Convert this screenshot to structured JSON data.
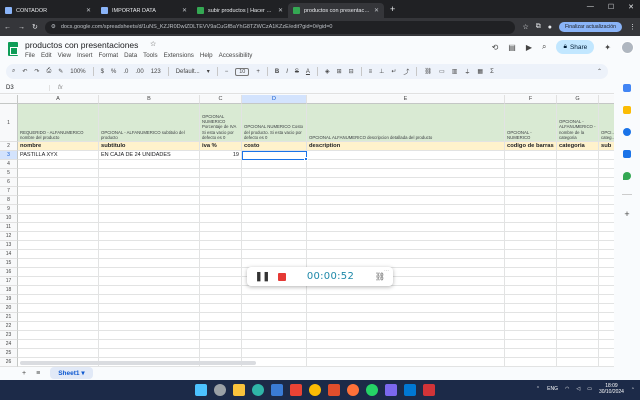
{
  "browser": {
    "tabs": [
      {
        "label": "CONTADOR",
        "color": "#8ab4f8",
        "active": false
      },
      {
        "label": "IMPORTAR DATA",
        "color": "#8ab4f8",
        "active": false
      },
      {
        "label": "subir productos | Hacer copia",
        "color": "#34a853",
        "active": false
      },
      {
        "label": "productos con presentaciones",
        "color": "#34a853",
        "active": true
      }
    ],
    "url": "docs.google.com/spreadsheets/d/1uNS_KZJR0DwlZDLTEVV9aCuGfBaYhG8TZWCzA1KZzE/edit?gid=0#gid=0",
    "update_button": "Finalizar actualización"
  },
  "sheets": {
    "title": "productos con presentaciones",
    "menus": [
      "File",
      "Edit",
      "View",
      "Insert",
      "Format",
      "Data",
      "Tools",
      "Extensions",
      "Help",
      "Accessibility"
    ],
    "share_label": "Share",
    "zoom": "100%",
    "font": "Default...",
    "font_size": "10",
    "name_box": "D3",
    "columns": [
      "A",
      "B",
      "C",
      "D",
      "E",
      "F",
      "G",
      "H"
    ],
    "rows": [
      "1",
      "2",
      "3",
      "4",
      "5",
      "6",
      "7",
      "8",
      "9",
      "10",
      "11",
      "12",
      "13",
      "14",
      "15",
      "16",
      "17",
      "18",
      "19",
      "20",
      "21",
      "22",
      "23",
      "24",
      "25",
      "26",
      "27",
      "28"
    ],
    "row1": [
      "REQUERIDO - ALFANUMERICO nombre del producto",
      "OPCIONAL - ALFANUMERICO subtitulo del producto",
      "OPCIONAL NUMERICO Porcentaje de IVA Si esta vacio por defecto es 0",
      "OPCIONAL NUMERICO Costo del producto. Si esta vacio por defecto es 0",
      "OPCIONAL ALFANUMERICO descripcion detallada del producto",
      "OPCIONAL - NUMERICO",
      "OPCIONAL - ALFANUMERICO - nombre de la categoria",
      "OPCI... nomb... categ..."
    ],
    "row2": [
      "nombre",
      "subtitulo",
      "iva %",
      "costo",
      "description",
      "codigo de barras",
      "categoria",
      "sub"
    ],
    "row3": [
      "PASTILLA XYX",
      "EN CAJA DE 24 UNIDADES",
      "19",
      "",
      "",
      "",
      "",
      ""
    ],
    "sheet_tab": "Sheet1"
  },
  "recorder": {
    "time": "00:00:52"
  },
  "taskbar": {
    "lang": "ENG",
    "time": "18:09",
    "date": "30/10/2024"
  }
}
